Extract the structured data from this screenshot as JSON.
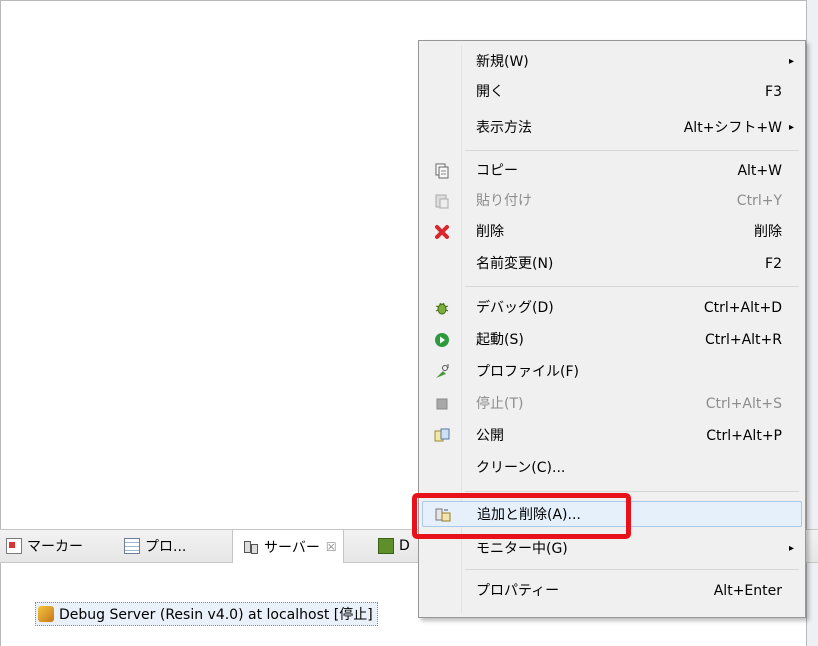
{
  "tabs": [
    {
      "label": "マーカー"
    },
    {
      "label": "プロ..."
    },
    {
      "label": "サーバー",
      "close": "☒"
    },
    {
      "label": "D"
    }
  ],
  "server_entry": {
    "label": "Debug Server (Resin v4.0) at localhost  [停止]"
  },
  "menu": {
    "items": [
      {
        "label": "新規(W)",
        "accel": "",
        "submenu": "▸"
      },
      {
        "label": "開く",
        "accel": "F3"
      },
      {
        "label": "表示方法",
        "accel": "Alt+シフト+W",
        "submenu": "▸"
      },
      {
        "label": "コピー",
        "accel": "Alt+W"
      },
      {
        "label": "貼り付け",
        "accel": "Ctrl+Y"
      },
      {
        "label": "削除",
        "accel": "削除"
      },
      {
        "label": "名前変更(N)",
        "accel": "F2"
      },
      {
        "label": "デバッグ(D)",
        "accel": "Ctrl+Alt+D"
      },
      {
        "label": "起動(S)",
        "accel": "Ctrl+Alt+R"
      },
      {
        "label": "プロファイル(F)",
        "accel": ""
      },
      {
        "label": "停止(T)",
        "accel": "Ctrl+Alt+S"
      },
      {
        "label": "公開",
        "accel": "Ctrl+Alt+P"
      },
      {
        "label": "クリーン(C)...",
        "accel": ""
      },
      {
        "label": "追加と削除(A)...",
        "accel": ""
      },
      {
        "label": "モニター中(G)",
        "accel": "",
        "submenu": "▸"
      },
      {
        "label": "プロパティー",
        "accel": "Alt+Enter"
      }
    ]
  },
  "colors": {
    "highlight": "#e8131a",
    "delete_icon": "#d9262c",
    "run_icon": "#2e9a3e"
  }
}
